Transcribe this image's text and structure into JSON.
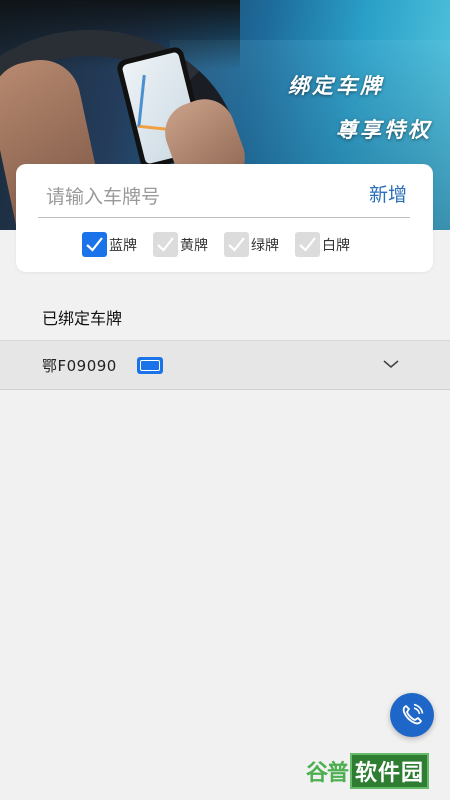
{
  "banner": {
    "slogan_line1": "绑定车牌",
    "slogan_line2": "尊享特权"
  },
  "form": {
    "plate_placeholder": "请输入车牌号",
    "plate_value": "",
    "add_label": "新增",
    "colors": [
      {
        "label": "蓝牌",
        "checked": true
      },
      {
        "label": "黄牌",
        "checked": false
      },
      {
        "label": "绿牌",
        "checked": false
      },
      {
        "label": "白牌",
        "checked": false
      }
    ]
  },
  "bound": {
    "title": "已绑定车牌",
    "plates": [
      {
        "number": "鄂F09090",
        "color": "#1a73e8"
      }
    ]
  },
  "call_icon": "phone-icon",
  "watermark": {
    "part1": "谷普",
    "part2": "软件园"
  },
  "accent_color": "#1a73e8"
}
